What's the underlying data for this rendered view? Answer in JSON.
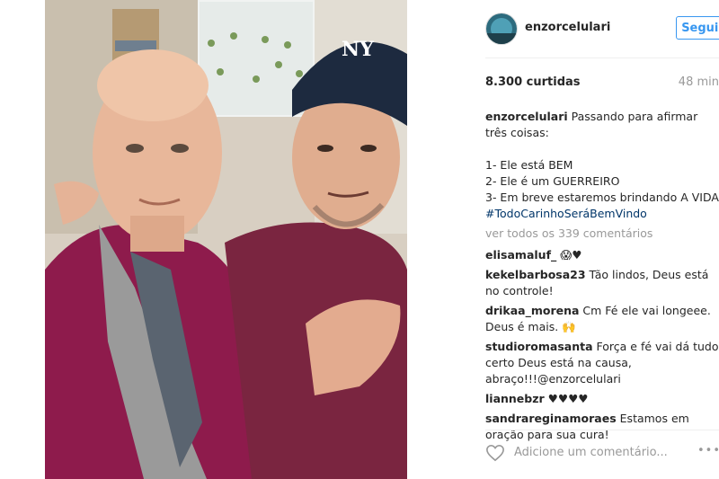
{
  "post": {
    "username": "enzorcelulari",
    "follow_label": "Seguir",
    "likes": "8.300 curtidas",
    "time": "48 min",
    "caption_user": "enzorcelulari",
    "caption": "Passando para afirmar três coisas:\n\n1- Ele está BEM\n2- Ele é um GUERREIRO\n3- Em breve estaremos brindando A VIDA ",
    "caption_tag": "#TodoCarinhoSeráBemVindo",
    "see_all": "ver todos os 339 comentários",
    "add_comment_placeholder": "Adicione um comentário...",
    "more": "•••"
  },
  "comments": [
    {
      "user": "elisamaluf_",
      "text": "😱♥"
    },
    {
      "user": "kekelbarbosa23",
      "text": "Tão lindos, Deus está no controle!"
    },
    {
      "user": "drikaa_morena",
      "text": "Cm Fé ele vai longeee. Deus é mais. 🙌"
    },
    {
      "user": "studioromasanta",
      "text": "Força e fé vai dá tudo certo Deus está na causa, abraço!!!@enzorcelulari"
    },
    {
      "user": "liannebzr",
      "text": "♥♥♥♥"
    },
    {
      "user": "sandrareginamoraes",
      "text": "Estamos em oração para sua cura!"
    }
  ],
  "colors": {
    "accent": "#3897f0",
    "hashtag": "#003569",
    "muted": "#999999"
  },
  "icons": {
    "like": "heart-outline-icon",
    "more": "more-dots-icon"
  }
}
